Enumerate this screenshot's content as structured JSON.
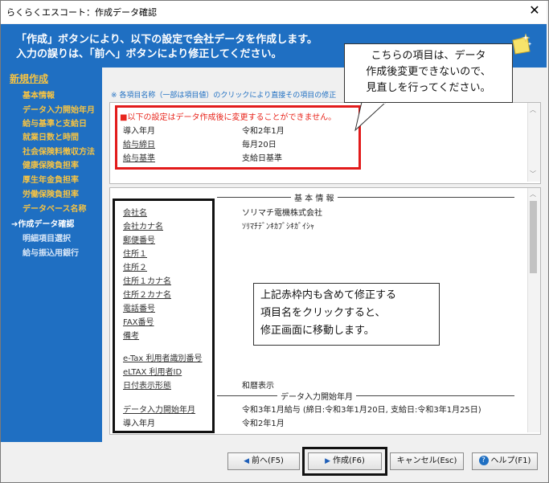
{
  "window": {
    "title": "らくらくエスコート：作成データ確認"
  },
  "header": {
    "line1": "「作成」ボタンにより、以下の設定で会社データを作成します。",
    "line2": "入力の誤りは、「前へ」ボタンにより修正してください。"
  },
  "sidebar": {
    "heading": "新規作成",
    "items": [
      {
        "label": "基本情報",
        "state": "done"
      },
      {
        "label": "データ入力開始年月",
        "state": "done"
      },
      {
        "label": "給与基準と支給日",
        "state": "done"
      },
      {
        "label": "就業日数と時間",
        "state": "done"
      },
      {
        "label": "社会保険料徴収方法",
        "state": "done"
      },
      {
        "label": "健康保険負担率",
        "state": "done"
      },
      {
        "label": "厚生年金負担率",
        "state": "done"
      },
      {
        "label": "労働保険負担率",
        "state": "done"
      },
      {
        "label": "データベース名称",
        "state": "done"
      },
      {
        "label": "➔作成データ確認",
        "state": "current"
      },
      {
        "label": "明細項目選択",
        "state": "todo"
      },
      {
        "label": "給与振込用銀行",
        "state": "todo"
      }
    ]
  },
  "note": "※ 各項目名称（一部は項目値）のクリックにより直接その項目の修正",
  "fixed": {
    "warning": "■以下の設定はデータ作成後に変更することができません。",
    "rows": [
      {
        "label": "導入年月",
        "value": "令和2年1月"
      },
      {
        "label": "給与締日",
        "value": "毎月20日"
      },
      {
        "label": "給与基準",
        "value": "支給日基準"
      }
    ]
  },
  "basic": {
    "section_title": "基 本 情 報",
    "rows": [
      {
        "label": "会社名",
        "value": "ソリマチ電機株式会社"
      },
      {
        "label": "会社カナ名",
        "value": "ｿﾘﾏﾁﾃﾞﾝｷｶﾌﾞｼｷｶﾞｲｼｬ"
      },
      {
        "label": "郵便番号",
        "value": ""
      },
      {
        "label": "住所１",
        "value": ""
      },
      {
        "label": "住所２",
        "value": ""
      },
      {
        "label": "住所１カナ名",
        "value": ""
      },
      {
        "label": "住所２カナ名",
        "value": ""
      },
      {
        "label": "電話番号",
        "value": ""
      },
      {
        "label": "FAX番号",
        "value": ""
      },
      {
        "label": "備考",
        "value": ""
      },
      {
        "label": "e-Tax 利用者識別番号",
        "value": ""
      },
      {
        "label": "eLTAX 利用者ID",
        "value": ""
      },
      {
        "label": "日付表示形態",
        "value": "和暦表示"
      }
    ]
  },
  "start": {
    "section_title": "データ入力開始年月",
    "rows": [
      {
        "label": "データ入力開始年月",
        "value": "令和3年1月給与 (締日:令和3年1月20日, 支給日:令和3年1月25日)"
      },
      {
        "label": "導入年月",
        "value": "令和2年1月"
      }
    ]
  },
  "callouts": {
    "top": [
      "こちらの項目は、データ",
      "作成後変更できないので、",
      "見直しを行ってください。"
    ],
    "middle": [
      "上記赤枠内も含めて修正する",
      "項目名をクリックすると、",
      "修正画面に移動します。"
    ]
  },
  "buttons": {
    "prev": "前へ(F5)",
    "create": "作成(F6)",
    "cancel": "キャンセル(Esc)",
    "help": "ヘルプ(F1)"
  },
  "colors": {
    "header_blue": "#1f6fc2",
    "sidebar_done": "#f6c343",
    "warning_red": "#e8261d"
  },
  "icons": [
    "close-icon",
    "sparkle-note-icon",
    "left-triangle-icon",
    "right-triangle-icon",
    "help-icon"
  ]
}
